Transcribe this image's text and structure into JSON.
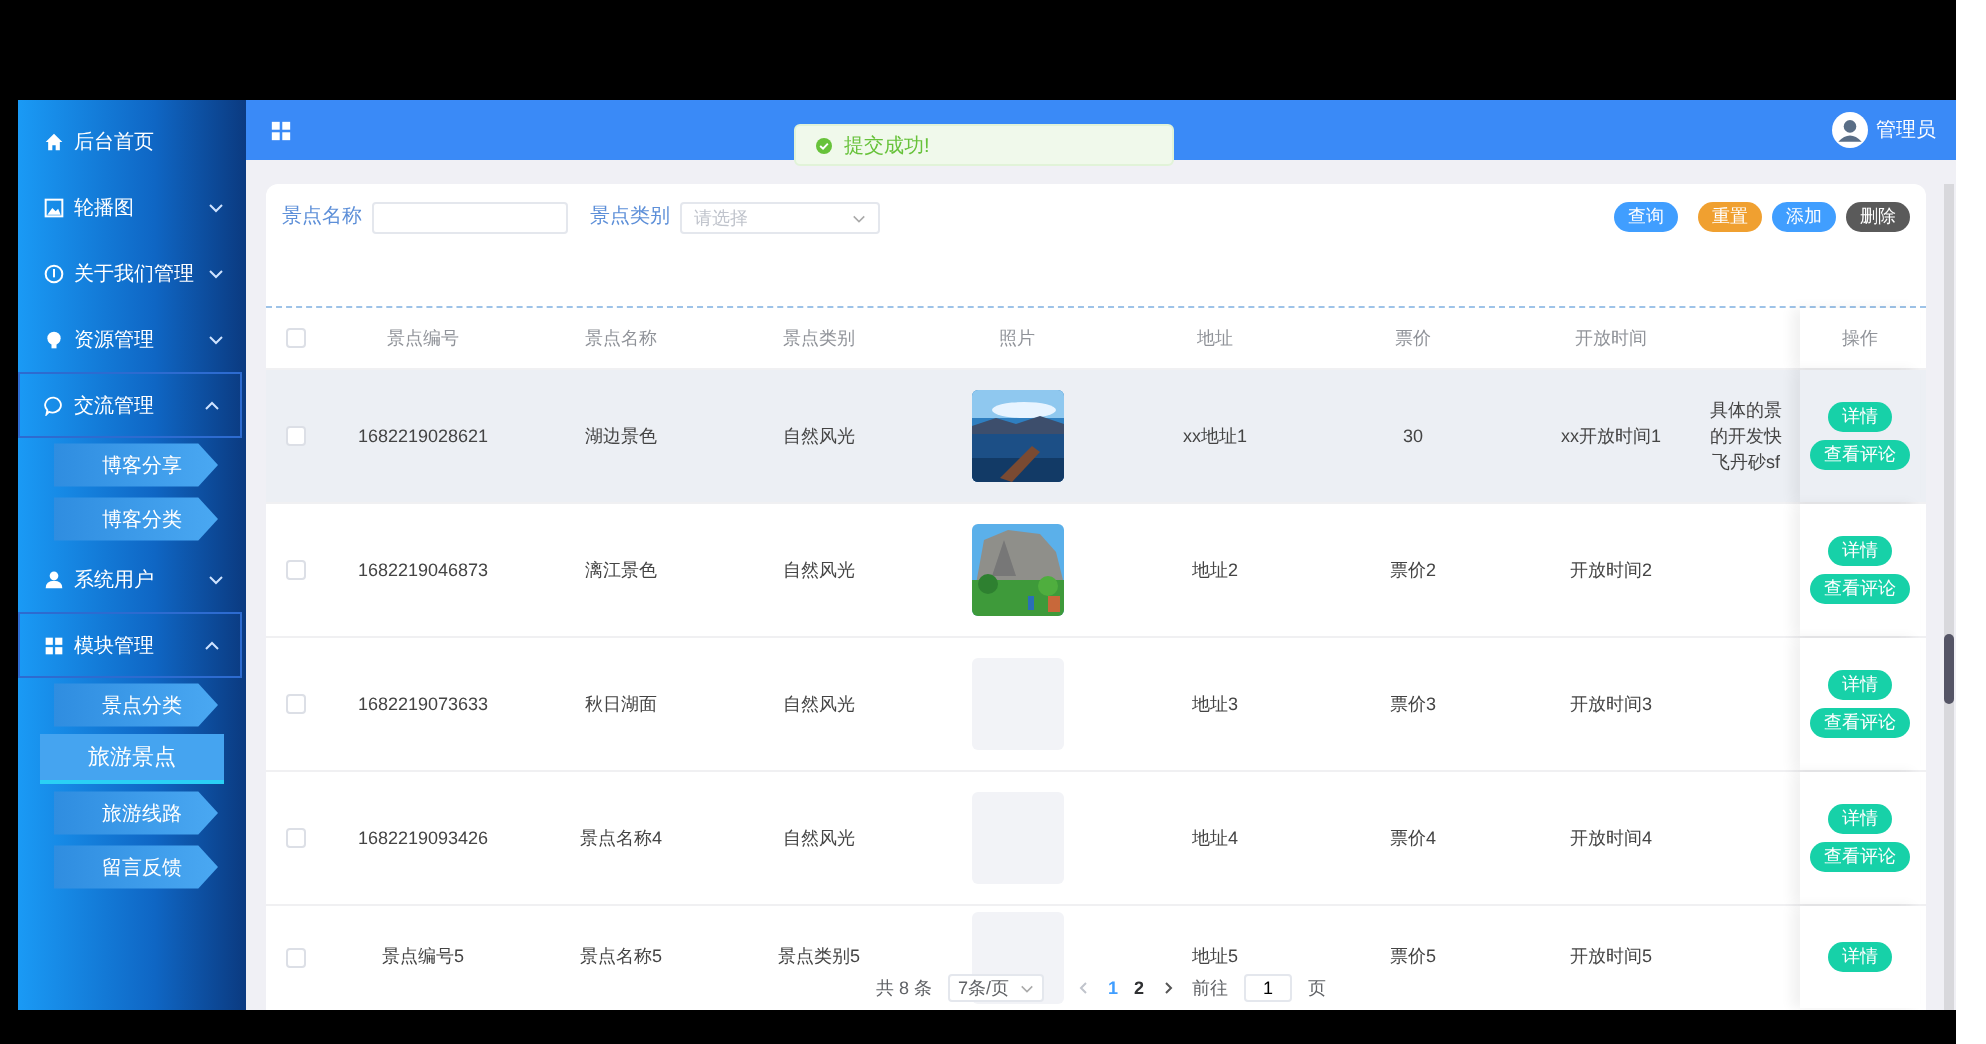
{
  "sidebar": {
    "items": [
      {
        "label": "后台首页"
      },
      {
        "label": "轮播图",
        "expanded": false
      },
      {
        "label": "关于我们管理",
        "expanded": false
      },
      {
        "label": "资源管理",
        "expanded": false
      },
      {
        "label": "交流管理",
        "expanded": true,
        "children": [
          {
            "label": "博客分享",
            "selected": false
          },
          {
            "label": "博客分类",
            "selected": false
          }
        ]
      },
      {
        "label": "系统用户",
        "expanded": false
      },
      {
        "label": "模块管理",
        "expanded": true,
        "children": [
          {
            "label": "景点分类",
            "selected": false
          },
          {
            "label": "旅游景点",
            "selected": true
          },
          {
            "label": "旅游线路",
            "selected": false
          },
          {
            "label": "留言反馈",
            "selected": false
          }
        ]
      }
    ]
  },
  "header": {
    "user": "管理员",
    "toast": {
      "text": "提交成功!"
    }
  },
  "filters": [
    {
      "kind": "text",
      "label": "景点名称"
    },
    {
      "kind": "select",
      "label": "景点类别",
      "placeholder": "请选择"
    }
  ],
  "buttons": [
    {
      "label": "查询",
      "kind": "primary"
    },
    {
      "label": "重置",
      "kind": "warning"
    },
    {
      "label": "添加",
      "kind": "primary"
    },
    {
      "label": "删除",
      "kind": "dark"
    }
  ],
  "table": {
    "all_checked": false,
    "columns": [
      "景点编号",
      "景点名称",
      "景点类别",
      "照片",
      "地址",
      "票价",
      "开放时间"
    ],
    "actions_column": "操作",
    "rows": [
      {
        "hovered": true,
        "checked": false,
        "cells": [
          "1682219028621",
          "湖边景色",
          "自然风光"
        ],
        "photo": {
          "kind": "picture"
        },
        "cells_after": [
          "xx地址1",
          "30",
          "xx开放时间1"
        ],
        "column_8": [
          "具体的景",
          "的开发快",
          "飞丹砂sf"
        ],
        "actions": [
          "详情",
          "查看评论"
        ]
      },
      {
        "hovered": false,
        "checked": false,
        "cells": [
          "1682219046873",
          "漓江景色",
          "自然风光"
        ],
        "photo": {
          "kind": "picture"
        },
        "cells_after": [
          "地址2",
          "票价2",
          "开放时间2"
        ],
        "actions": [
          "详情",
          "查看评论"
        ]
      },
      {
        "hovered": false,
        "checked": false,
        "cells": [
          "1682219073633",
          "秋日湖面",
          "自然风光"
        ],
        "photo": {
          "kind": "empty"
        },
        "cells_after": [
          "地址3",
          "票价3",
          "开放时间3"
        ],
        "actions": [
          "详情",
          "查看评论"
        ]
      },
      {
        "hovered": false,
        "checked": false,
        "cells": [
          "1682219093426",
          "景点名称4",
          "自然风光"
        ],
        "photo": {
          "kind": "empty"
        },
        "cells_after": [
          "地址4",
          "票价4",
          "开放时间4"
        ],
        "actions": [
          "详情",
          "查看评论"
        ]
      },
      {
        "hovered": false,
        "checked": false,
        "cells": [
          "景点编号5",
          "景点名称5",
          "景点类别5"
        ],
        "photo": {
          "kind": "empty"
        },
        "cells_after": [
          "地址5",
          "票价5",
          "开放时间5"
        ],
        "actions": [
          "详情"
        ]
      }
    ]
  },
  "pagination": {
    "total": "共 8 条",
    "page_size": "7条/页",
    "prev_disabled": true,
    "pages": [
      {
        "label": "1",
        "selected": true
      },
      {
        "label": "2",
        "selected": false
      }
    ],
    "goto_label": "前往",
    "goto_value": "1",
    "goto_suffix": "页"
  }
}
